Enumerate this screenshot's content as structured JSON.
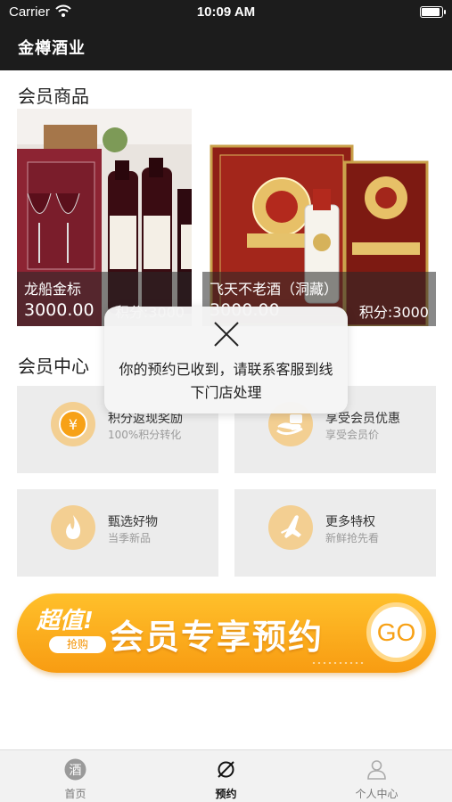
{
  "status_bar": {
    "carrier": "Carrier",
    "time": "10:09 AM"
  },
  "header": {
    "title": "金樽酒业"
  },
  "member_products": {
    "title": "会员商品",
    "items": [
      {
        "name": "龙船金标",
        "price": "3000.00",
        "points": "积分:3000"
      },
      {
        "name": "飞天不老酒（洞藏）",
        "price": "3000.00",
        "points": "积分:3000"
      }
    ]
  },
  "member_center": {
    "title": "会员中心",
    "cards": [
      {
        "title": "积分返现奖励",
        "subtitle": "100%积分转化",
        "icon": "yen-coin-icon"
      },
      {
        "title": "享受会员优惠",
        "subtitle": "享受会员价",
        "icon": "discount-hand-icon"
      },
      {
        "title": "甄选好物",
        "subtitle": "当季新品",
        "icon": "flame-icon"
      },
      {
        "title": "更多特权",
        "subtitle": "新鲜抢先看",
        "icon": "airplane-icon"
      }
    ]
  },
  "banner": {
    "tag_big": "超值!",
    "tag_small": "抢购",
    "text": "会员专享预约",
    "go": "GO"
  },
  "toast": {
    "message": "你的预约已收到，请联系客服到线下门店处理",
    "icon": "close-icon"
  },
  "tabbar": {
    "active_index": 1,
    "tabs": [
      {
        "label": "首页",
        "icon": "wine-badge-icon"
      },
      {
        "label": "预约",
        "icon": "compass-icon"
      },
      {
        "label": "个人中心",
        "icon": "person-icon"
      }
    ]
  },
  "colors": {
    "accent": "#f7a116",
    "nav_bg": "#1c1c1c",
    "card_bg": "#ececec",
    "icon_disc": "#f3cf92"
  }
}
